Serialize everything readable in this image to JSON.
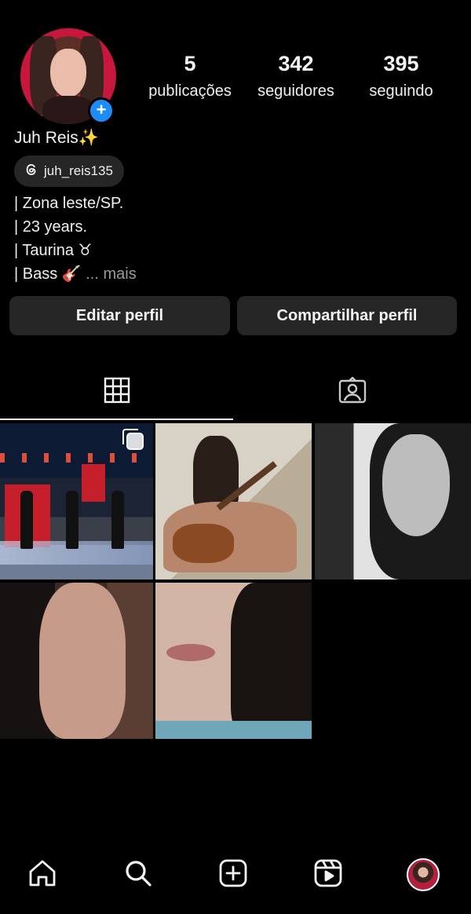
{
  "profile": {
    "name": "Juh Reis✨",
    "threads_handle": "juh_reis135",
    "bio_lines": [
      "| Zona leste/SP.",
      "| 23 years.",
      "| Taurina ♉",
      "| Bass 🎸"
    ],
    "bio_more": "... mais"
  },
  "stats": {
    "posts_count": "5",
    "posts_label": "publicações",
    "followers_count": "342",
    "followers_label": "seguidores",
    "following_count": "395",
    "following_label": "seguindo"
  },
  "buttons": {
    "edit_profile": "Editar perfil",
    "share_profile": "Compartilhar perfil"
  },
  "tabs": {
    "active": "grid",
    "items": [
      "grid-icon",
      "tagged-icon"
    ]
  },
  "posts": [
    {
      "icon": "carousel-icon"
    },
    {},
    {},
    {},
    {}
  ],
  "bottom_nav": {
    "items": [
      "home-icon",
      "search-icon",
      "create-icon",
      "reels-icon",
      "profile-avatar"
    ]
  },
  "colors": {
    "background": "#000000",
    "button_bg": "#262626",
    "accent_blue": "#1d8cf8",
    "muted_text": "#9a9a9a"
  }
}
